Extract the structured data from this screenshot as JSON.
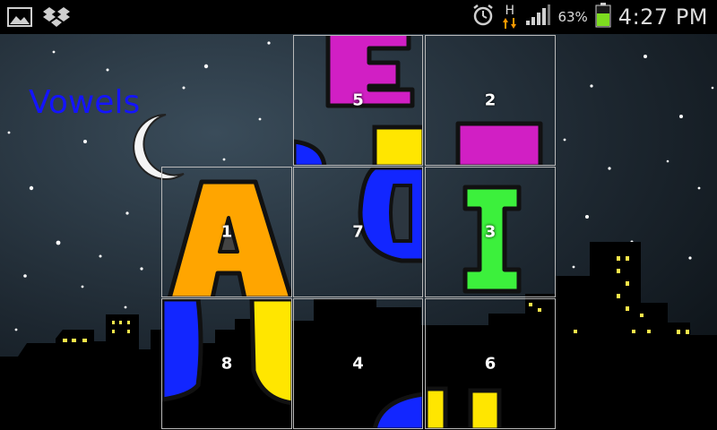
{
  "status_bar": {
    "battery_percent": "63%",
    "time": "4:27 PM",
    "network_type": "H",
    "icons": [
      "gallery-icon",
      "dropbox-icon",
      "alarm-icon",
      "network-h-icon",
      "signal-icon",
      "battery-icon"
    ]
  },
  "game": {
    "title": "Vowels",
    "tiles": [
      {
        "label": "5",
        "piece": "E-top"
      },
      {
        "label": "2",
        "piece": "E-bottom"
      },
      {
        "label": "1",
        "piece": "A"
      },
      {
        "label": "7",
        "piece": "O-right"
      },
      {
        "label": "3",
        "piece": "I"
      },
      {
        "label": "8",
        "piece": "O-U-left"
      },
      {
        "label": "4",
        "piece": "O-bottom"
      },
      {
        "label": "6",
        "piece": "U-bottom"
      }
    ]
  },
  "colors": {
    "title": "#1414ff",
    "letter_magenta": "#d11fc4",
    "letter_orange": "#ffa500",
    "letter_blue": "#1226ff",
    "letter_yellow": "#ffe600",
    "letter_green": "#3cf03c"
  }
}
